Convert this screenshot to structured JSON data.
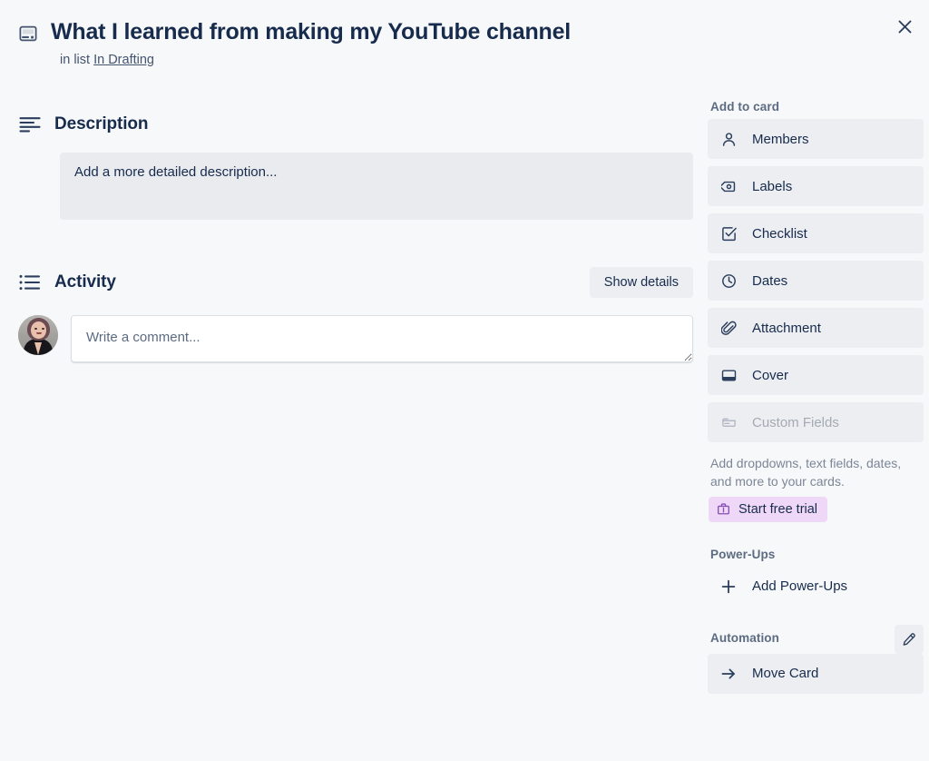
{
  "window": {
    "close_label": "Close",
    "close_icon": "close-icon"
  },
  "card": {
    "icon": "card-template-icon",
    "title": "What I learned from making my YouTube channel",
    "in_list_prefix": "in list",
    "list_name": "In Drafting"
  },
  "description": {
    "icon": "description-lines-icon",
    "heading": "Description",
    "placeholder": "Add a more detailed description..."
  },
  "activity": {
    "icon": "activity-list-icon",
    "heading": "Activity",
    "show_details_label": "Show details",
    "avatar_name": "user-avatar",
    "comment_placeholder": "Write a comment...",
    "comment_value": ""
  },
  "sidebar": {
    "add_to_card": {
      "heading": "Add to card",
      "items": [
        {
          "label": "Members",
          "icon": "person-icon",
          "disabled": false
        },
        {
          "label": "Labels",
          "icon": "tag-icon",
          "disabled": false
        },
        {
          "label": "Checklist",
          "icon": "checkbox-icon",
          "disabled": false
        },
        {
          "label": "Dates",
          "icon": "clock-icon",
          "disabled": false
        },
        {
          "label": "Attachment",
          "icon": "paperclip-icon",
          "disabled": false
        },
        {
          "label": "Cover",
          "icon": "cover-icon",
          "disabled": false
        },
        {
          "label": "Custom Fields",
          "icon": "custom-fields-icon",
          "disabled": true
        }
      ]
    },
    "upsell": {
      "text": "Add dropdowns, text fields, dates, and more to your cards.",
      "trial_label": "Start free trial",
      "trial_icon": "briefcase-icon",
      "trial_bg": "#efd8f7",
      "trial_icon_color": "#8650b5"
    },
    "power_ups": {
      "heading": "Power-Ups",
      "add_label": "Add Power-Ups",
      "add_icon": "plus-icon"
    },
    "automation": {
      "heading": "Automation",
      "edit_icon": "pencil-icon",
      "items": [
        {
          "label": "Move Card",
          "icon": "arrow-right-icon"
        }
      ]
    }
  },
  "colors": {
    "page_bg": "#f7f8f9",
    "text_primary": "#172b4d",
    "text_subtle": "#5d6b82",
    "surface_subtle": "#eceef1",
    "surface_description": "#e9ebee"
  }
}
